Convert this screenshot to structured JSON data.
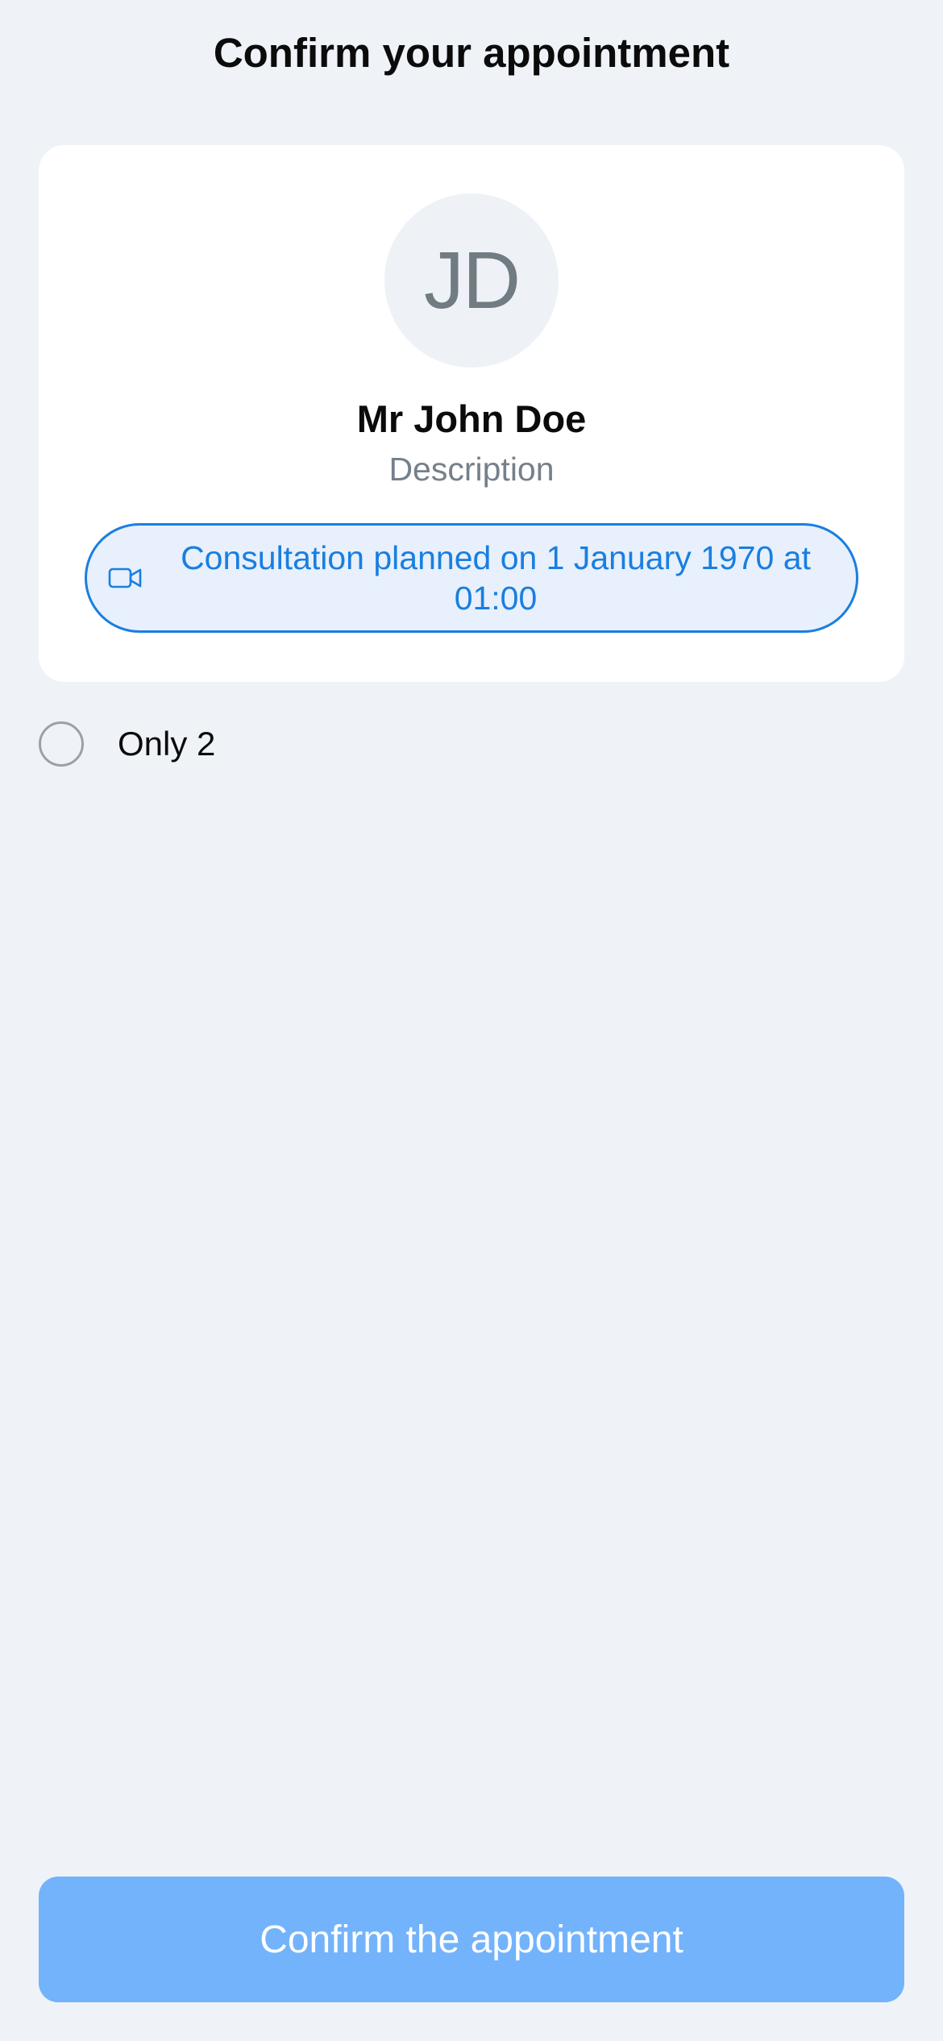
{
  "header": {
    "title": "Confirm your appointment"
  },
  "doctor_card": {
    "avatar_initials": "JD",
    "name": "Mr John Doe",
    "description": "Description",
    "consultation": {
      "icon": "video-camera-icon",
      "text": "Consultation planned on 1 January 1970 at 01:00"
    }
  },
  "options": [
    {
      "label": "Only 2",
      "selected": false
    }
  ],
  "footer": {
    "confirm_label": "Confirm the appointment",
    "confirm_enabled": false
  },
  "colors": {
    "background": "#eff3f8",
    "card": "#ffffff",
    "accent": "#1a7ee0",
    "pill_fill": "#e7f0fc",
    "button_disabled": "#73b3fc",
    "muted_text": "#76808a"
  }
}
